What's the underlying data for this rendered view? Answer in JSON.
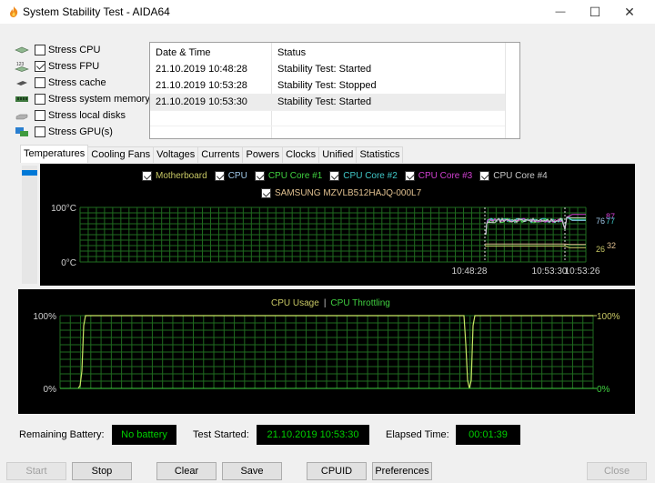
{
  "window": {
    "title": "System Stability Test - AIDA64",
    "controls": {
      "minimize": "—",
      "maximize": "☐",
      "close": "✕"
    }
  },
  "stress_options": [
    {
      "label": "Stress CPU",
      "checked": false,
      "icon": "cpu-chip-icon"
    },
    {
      "label": "Stress FPU",
      "checked": true,
      "icon": "fpu-chip-icon"
    },
    {
      "label": "Stress cache",
      "checked": false,
      "icon": "cache-icon"
    },
    {
      "label": "Stress system memory",
      "checked": false,
      "icon": "memory-module-icon"
    },
    {
      "label": "Stress local disks",
      "checked": false,
      "icon": "disk-drive-icon"
    },
    {
      "label": "Stress GPU(s)",
      "checked": false,
      "icon": "gpu-card-icon"
    }
  ],
  "log": {
    "columns": [
      "Date & Time",
      "Status"
    ],
    "rows": [
      {
        "datetime": "21.10.2019 10:48:28",
        "status": "Stability Test: Started"
      },
      {
        "datetime": "21.10.2019 10:53:28",
        "status": "Stability Test: Stopped"
      },
      {
        "datetime": "21.10.2019 10:53:30",
        "status": "Stability Test: Started",
        "selected": true
      }
    ]
  },
  "tabs": [
    {
      "label": "Temperatures",
      "active": true
    },
    {
      "label": "Cooling Fans"
    },
    {
      "label": "Voltages"
    },
    {
      "label": "Currents"
    },
    {
      "label": "Powers"
    },
    {
      "label": "Clocks"
    },
    {
      "label": "Unified"
    },
    {
      "label": "Statistics"
    }
  ],
  "temperature_graph": {
    "legend": [
      {
        "label": "Motherboard",
        "color": "#c8c864",
        "checked": true
      },
      {
        "label": "CPU",
        "color": "#a0c8e8",
        "checked": true
      },
      {
        "label": "CPU Core #1",
        "color": "#40d040",
        "checked": true
      },
      {
        "label": "CPU Core #2",
        "color": "#40c8c8",
        "checked": true
      },
      {
        "label": "CPU Core #3",
        "color": "#d040d0",
        "checked": true
      },
      {
        "label": "CPU Core #4",
        "color": "#c8c8c8",
        "checked": true
      },
      {
        "label": "SAMSUNG MZVLB512HAJQ-000L7",
        "color": "#e0c090",
        "checked": true
      }
    ],
    "y_max_label": "100°C",
    "y_min_label": "0°C",
    "y_max_value": 100,
    "y_min_value": 0,
    "x_labels": [
      "10:48:28",
      "10:53:30",
      "10:53:26"
    ],
    "current_values": [
      {
        "value": "87",
        "color": "#d040d0"
      },
      {
        "value": "77",
        "color": "#40c8c8"
      },
      {
        "value": "76",
        "color": "#a0c8e8"
      },
      {
        "value": "26",
        "color": "#c8c864"
      },
      {
        "value": "32",
        "color": "#e0c090"
      }
    ]
  },
  "cpu_graph": {
    "legend": [
      {
        "label": "CPU Usage",
        "color": "#c8c864"
      },
      {
        "label": "CPU Throttling",
        "color": "#40d040"
      }
    ],
    "separator": "|",
    "left_max_label": "100%",
    "left_min_label": "0%",
    "right_max_label": "100%",
    "right_min_label": "0%"
  },
  "status": {
    "battery_label": "Remaining Battery:",
    "battery_value": "No battery",
    "started_label": "Test Started:",
    "started_value": "21.10.2019 10:53:30",
    "elapsed_label": "Elapsed Time:",
    "elapsed_value": "00:01:39"
  },
  "buttons": {
    "start": {
      "label": "Start",
      "enabled": false
    },
    "stop": {
      "label": "Stop",
      "enabled": true
    },
    "clear": {
      "label": "Clear",
      "enabled": true
    },
    "save": {
      "label": "Save",
      "enabled": true
    },
    "cpuid": {
      "label": "CPUID",
      "enabled": true
    },
    "preferences": {
      "label": "Preferences",
      "enabled": true
    },
    "close": {
      "label": "Close",
      "enabled": false
    }
  }
}
